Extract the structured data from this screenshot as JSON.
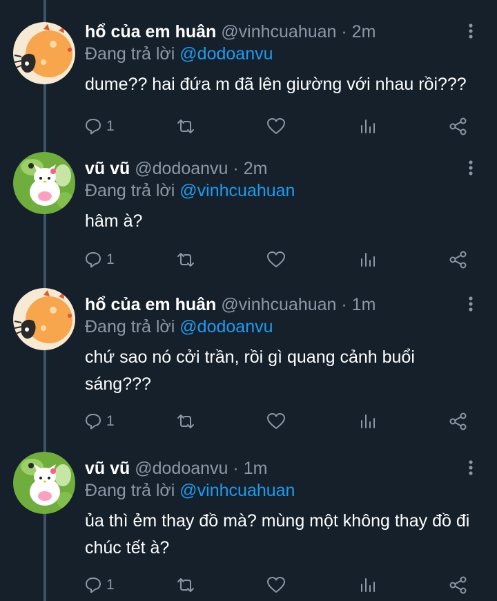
{
  "tweets": [
    {
      "name": "hổ của em huân",
      "handle": "@vinhcuahuan",
      "separator": "·",
      "time": "2m",
      "reply_prefix": "Đang trả lời",
      "reply_to": "@dodoanvu",
      "text": "dume?? hai đứa m đã lên giường với nhau rồi???",
      "reply_count": "1",
      "avatar": "tiger-cat-avatar"
    },
    {
      "name": "vũ vũ",
      "handle": "@dodoanvu",
      "separator": "·",
      "time": "2m",
      "reply_prefix": "Đang trả lời",
      "reply_to": "@vinhcuahuan",
      "text": "hâm à?",
      "reply_count": "1",
      "avatar": "hello-kitty-frog-avatar"
    },
    {
      "name": "hổ của em huân",
      "handle": "@vinhcuahuan",
      "separator": "·",
      "time": "1m",
      "reply_prefix": "Đang trả lời",
      "reply_to": "@dodoanvu",
      "text": "chứ sao nó cởi trần, rồi gì quang cảnh buổi sáng???",
      "reply_count": "1",
      "avatar": "tiger-cat-avatar"
    },
    {
      "name": "vũ vũ",
      "handle": "@dodoanvu",
      "separator": "·",
      "time": "1m",
      "reply_prefix": "Đang trả lời",
      "reply_to": "@vinhcuahuan",
      "text": "ủa thì ẻm thay đồ mà? mùng một không thay đồ đi chúc tết à?",
      "reply_count": "1",
      "avatar": "hello-kitty-frog-avatar"
    }
  ],
  "colors": {
    "background": "#15202b",
    "secondary_text": "#8b98a5",
    "link": "#1d9bf0",
    "thread_line": "#3d5466"
  }
}
